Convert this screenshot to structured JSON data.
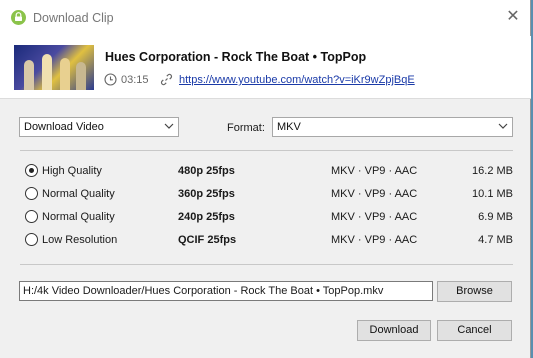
{
  "window": {
    "title": "Download Clip"
  },
  "video": {
    "title": "Hues Corporation - Rock The Boat • TopPop",
    "duration": "03:15",
    "url": "https://www.youtube.com/watch?v=iKr9wZpjBqE"
  },
  "download_type": {
    "selected": "Download Video"
  },
  "format": {
    "label": "Format:",
    "selected": "MKV"
  },
  "qualities": [
    {
      "label": "High Quality",
      "resolution": "480p 25fps",
      "codecs": "MKV · VP9 · AAC",
      "size": "16.2 MB",
      "selected": true
    },
    {
      "label": "Normal Quality",
      "resolution": "360p 25fps",
      "codecs": "MKV · VP9 · AAC",
      "size": "10.1 MB",
      "selected": false
    },
    {
      "label": "Normal Quality",
      "resolution": "240p 25fps",
      "codecs": "MKV · VP9 · AAC",
      "size": "6.9 MB",
      "selected": false
    },
    {
      "label": "Low Resolution",
      "resolution": "QCIF 25fps",
      "codecs": "MKV · VP9 · AAC",
      "size": "4.7 MB",
      "selected": false
    }
  ],
  "output": {
    "path": "H:/4k Video Downloader/Hues Corporation - Rock The Boat • TopPop.mkv",
    "browse_label": "Browse"
  },
  "actions": {
    "download_label": "Download",
    "cancel_label": "Cancel"
  },
  "colors": {
    "app_icon": "#8bc34a",
    "link": "#1a3aa8",
    "background_desktop": "#5a8fb0"
  }
}
